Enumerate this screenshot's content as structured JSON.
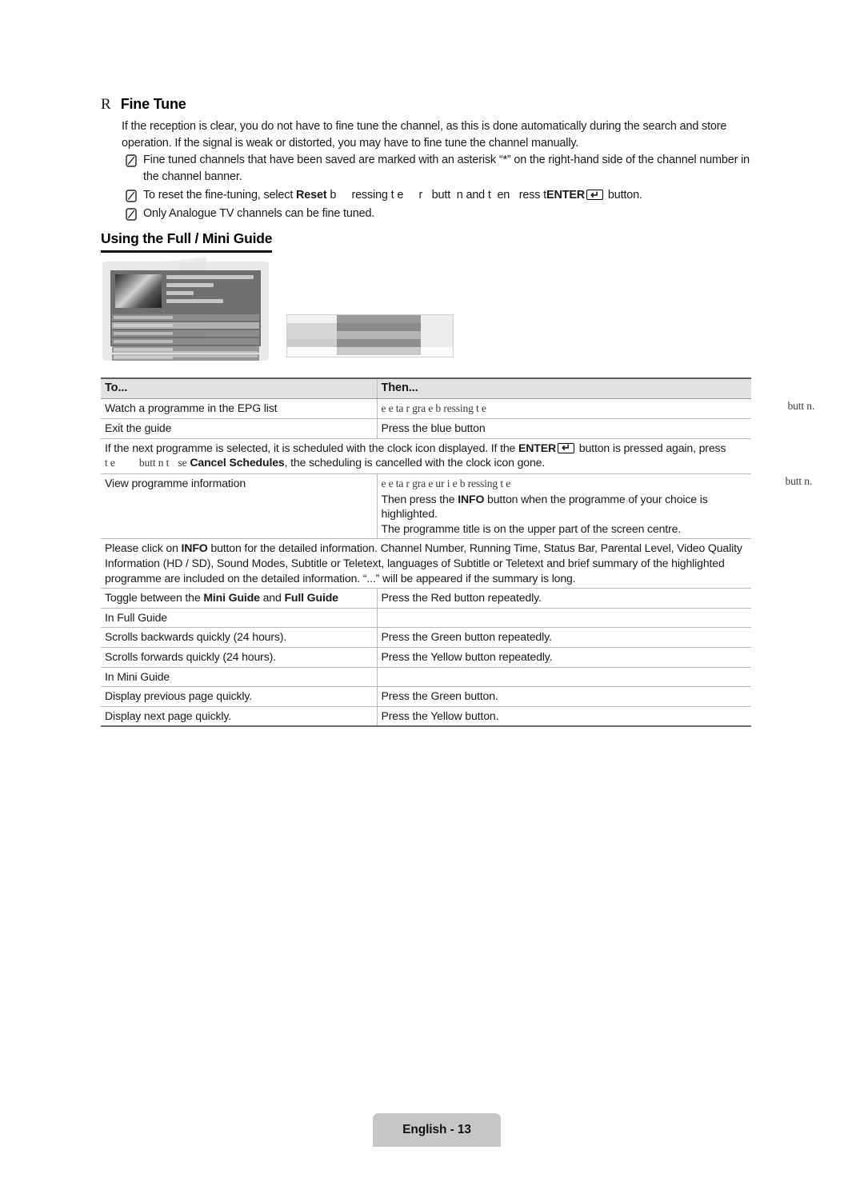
{
  "section": {
    "marker": "R",
    "title": "Fine Tune",
    "paragraph": "If the reception is clear, you do not have to fine tune the channel, as this is done automatically during the search and store operation. If the signal is weak or distorted, you may have to fine tune the channel manually."
  },
  "notes": [
    {
      "icon": "note-icon",
      "text": "Fine tuned channels that have been saved are marked with an asterisk “*” on the right-hand side of the channel number in the channel banner."
    },
    {
      "icon": "note-icon",
      "pre": "To reset the fine-tuning, select ",
      "bold": "Reset",
      "mid_a": " b",
      "mid_b": "ressing t",
      "mid_c": "e",
      "mid_d": "r",
      "mid_e": "butt",
      "mid_f": "n and t",
      "mid_g": "en",
      "mid_h": "ress t",
      "enter": "ENTER",
      "post": " button."
    },
    {
      "icon": "note-icon",
      "text": "Only Analogue TV channels can be fine tuned."
    }
  ],
  "subsection": {
    "title": "Using the Full / Mini Guide"
  },
  "figures": {
    "full_guide_caption": "full-guide-screenshot",
    "mini_guide_caption": "mini-guide-screenshot"
  },
  "table": {
    "header": {
      "col1": "To...",
      "col2": "Then..."
    },
    "rows": [
      {
        "type": "pair",
        "col1": "Watch a programme in the EPG list",
        "col2_faded": "e  e   ta   r   gra      e b        ressing t  e",
        "col2_spill": "butt   n."
      },
      {
        "type": "pair",
        "col1": "Exit the guide",
        "col2": "Press the blue button"
      },
      {
        "type": "span",
        "text_a": "If the next programme is selected, it is scheduled with the clock icon displayed. If the ",
        "bold_a": "ENTER",
        "text_b": " button is pressed again, press",
        "line2_faded_a": "t  e",
        "line2_faded_b": "butt   n t",
        "line2_faded_c": "se",
        "bold_b": "Cancel Schedules",
        "text_c": ", the scheduling is cancelled with the clock icon gone."
      },
      {
        "type": "pair-multiline",
        "col1": "View programme information",
        "col2_faded": "e   e   ta   r   gra     e              ur        i   e b        ressing t  e",
        "col2_spill": "butt   n.",
        "col2_lines": [
          "Then press the INFO button when the programme of your choice is",
          "highlighted.",
          "The programme title is on the upper part of the screen centre."
        ],
        "col2_line1_pre": "Then press the ",
        "col2_line1_bold": "INFO",
        "col2_line1_post": " button when the programme of your choice is highlighted.",
        "col2_line2": "The programme title is on the upper part of the screen centre."
      },
      {
        "type": "span",
        "note_pre": "Please click on ",
        "note_bold": "INFO",
        "note_post": " button for the detailed information. Channel Number, Running Time, Status Bar, Parental Level, Video Quality Information (HD / SD), Sound Modes, Subtitle or Teletext, languages of Subtitle or Teletext and brief summary of the highlighted programme are included on the detailed information. “...” will be appeared if the summary is long."
      },
      {
        "type": "pair",
        "col1_pre": "Toggle between the ",
        "col1_bold1": "Mini Guide",
        "col1_mid": " and ",
        "col1_bold2": "Full Guide",
        "col2": "Press the Red button repeatedly."
      },
      {
        "type": "pair",
        "col1": "In Full Guide",
        "col2": ""
      },
      {
        "type": "pair",
        "col1": "Scrolls backwards quickly (24 hours).",
        "col2": "Press the Green button repeatedly."
      },
      {
        "type": "pair",
        "col1": "Scrolls forwards quickly (24 hours).",
        "col2": "Press the Yellow button repeatedly."
      },
      {
        "type": "pair",
        "col1": "In Mini Guide",
        "col2": ""
      },
      {
        "type": "pair",
        "col1": "Display previous page quickly.",
        "col2": "Press the Green button."
      },
      {
        "type": "pair",
        "col1": "Display next page quickly.",
        "col2": "Press the Yellow button."
      }
    ]
  },
  "footer": {
    "label": "English - 13"
  },
  "colors": {
    "header_bg": "#e2e2e2",
    "footer_bg": "#c6c6c6",
    "rule": "#b9b9b9",
    "text": "#1a1a1a"
  }
}
